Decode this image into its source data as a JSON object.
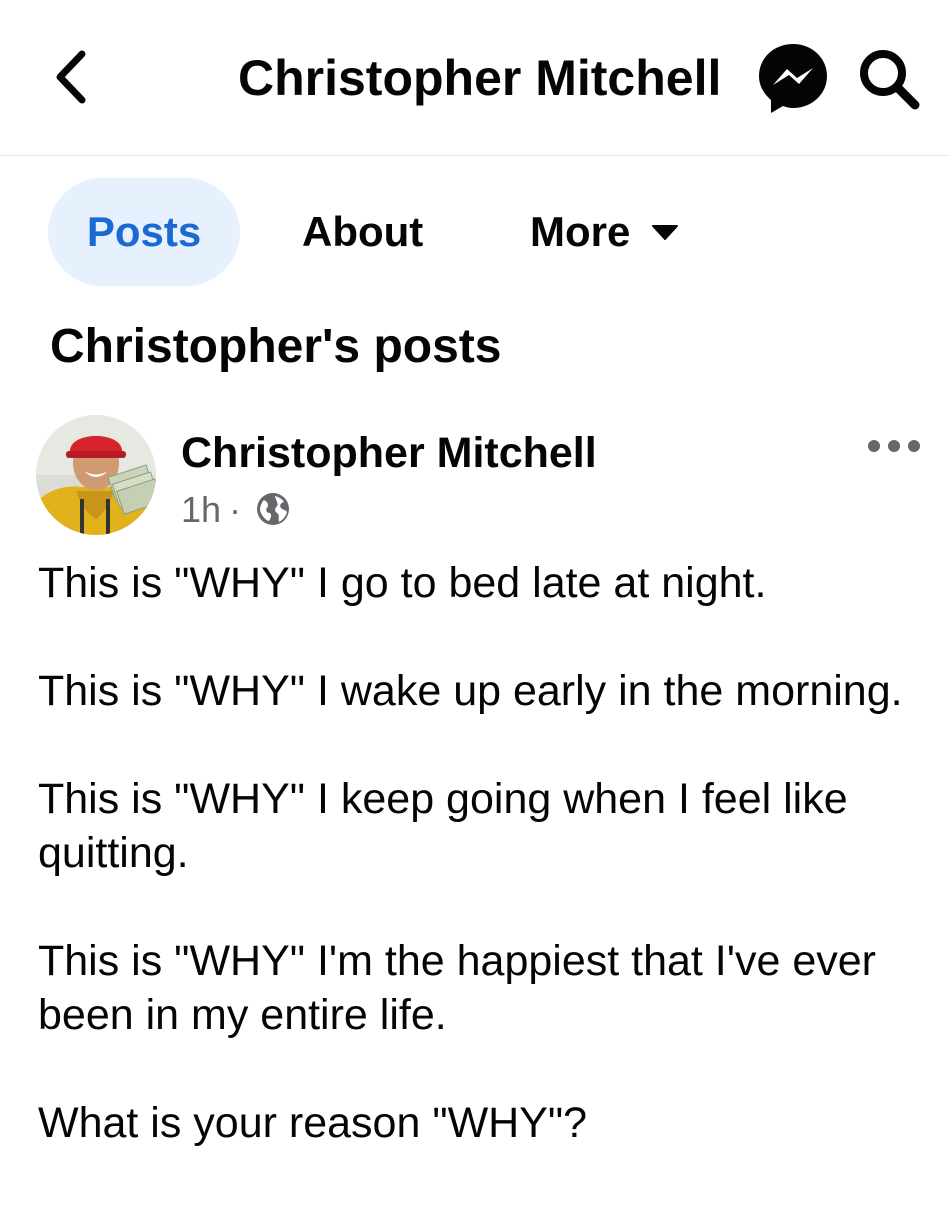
{
  "header": {
    "title": "Christopher Mitchell",
    "icons": {
      "back": "chevron-left-icon",
      "messenger": "messenger-icon",
      "search": "search-icon"
    }
  },
  "tabs": [
    {
      "label": "Posts",
      "active": true
    },
    {
      "label": "About",
      "active": false
    },
    {
      "label": "More",
      "active": false,
      "icon": "caret-down-icon"
    }
  ],
  "section": {
    "title": "Christopher's posts"
  },
  "post": {
    "author": "Christopher Mitchell",
    "time": "1h",
    "separator": "·",
    "audience_icon": "globe-icon",
    "more_icon": "more-options-icon",
    "paragraphs": [
      "This is \"WHY\" I go to bed late at night.",
      "This is \"WHY\" I wake up early in the morning.",
      "This is \"WHY\" I keep going when I feel like quitting.",
      "This is \"WHY\" I'm the happiest that I've ever been in my entire life.",
      "What is your reason \"WHY\"?"
    ]
  },
  "colors": {
    "accent": "#1b6ad4",
    "active_tab_bg": "#e7f0fd",
    "secondary_text": "#65676b",
    "divider": "#e4e6eb"
  }
}
